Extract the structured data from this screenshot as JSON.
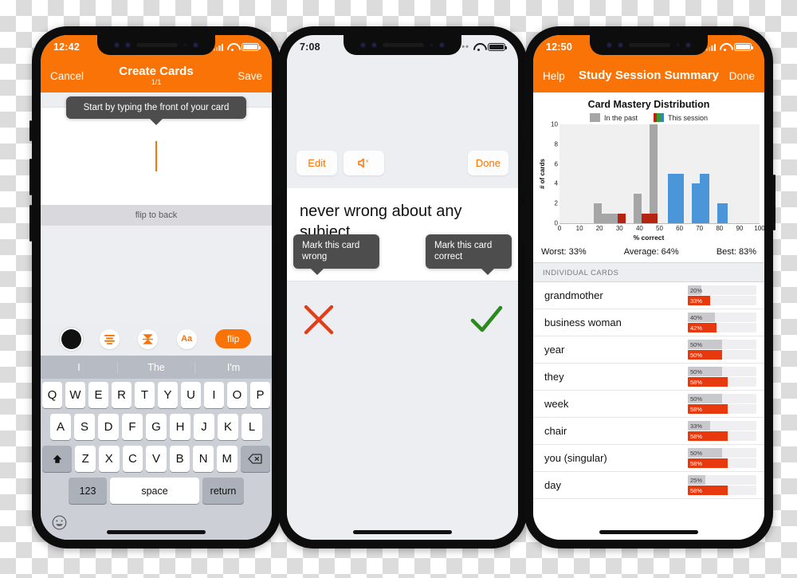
{
  "phone1": {
    "status": {
      "time": "12:42",
      "signal_icon": "signal-bars-icon",
      "wifi_icon": "wifi-icon",
      "battery_icon": "battery-icon"
    },
    "nav": {
      "left": "Cancel",
      "title": "Create Cards",
      "subtitle": "1/1",
      "right": "Save"
    },
    "tooltip": "Start by typing the front of your card",
    "flip_hint": "flip to back",
    "toolbar": {
      "color_swatch": "color-dot",
      "align_icon": "text-align-icon",
      "vertical_align_icon": "vertical-align-icon",
      "font_icon": "Aa",
      "flip_label": "flip"
    },
    "keyboard": {
      "suggestions": [
        "I",
        "The",
        "I'm"
      ],
      "row1": [
        "Q",
        "W",
        "E",
        "R",
        "T",
        "Y",
        "U",
        "I",
        "O",
        "P"
      ],
      "row2": [
        "A",
        "S",
        "D",
        "F",
        "G",
        "H",
        "J",
        "K",
        "L"
      ],
      "row3": [
        "Z",
        "X",
        "C",
        "V",
        "B",
        "N",
        "M"
      ],
      "shift_icon": "shift-arrow-icon",
      "backspace_icon": "backspace-icon",
      "numbers_label": "123",
      "space_label": "space",
      "return_label": "return",
      "emoji_icon": "emoji-face-icon"
    }
  },
  "phone2": {
    "status": {
      "time": "7:08",
      "signal_icon": "signal-dots-icon",
      "wifi_icon": "wifi-icon",
      "battery_icon": "battery-icon"
    },
    "controls": {
      "edit": "Edit",
      "mute_icon": "speaker-mute-icon",
      "done": "Done"
    },
    "card_text": "never wrong about any subject",
    "tooltip_wrong": "Mark this card wrong",
    "tooltip_correct": "Mark this card correct",
    "wrong_icon": "x-mark-icon",
    "correct_icon": "check-mark-icon",
    "colors": {
      "wrong": "#e33c18",
      "correct": "#2b8a1f"
    }
  },
  "phone3": {
    "status": {
      "time": "12:50",
      "signal_icon": "signal-bars-icon",
      "wifi_icon": "wifi-icon",
      "battery_icon": "battery-icon"
    },
    "nav": {
      "left": "Help",
      "title": "Study Session Summary",
      "right": "Done"
    },
    "stats": {
      "worst": "Worst: 33%",
      "average": "Average: 64%",
      "best": "Best: 83%"
    },
    "section_header": "INDIVIDUAL CARDS",
    "cards": [
      {
        "name": "grandmother",
        "past": "20%",
        "past_value": 20,
        "now": "33%",
        "now_value": 33
      },
      {
        "name": "business woman",
        "past": "40%",
        "past_value": 40,
        "now": "42%",
        "now_value": 42
      },
      {
        "name": "year",
        "past": "50%",
        "past_value": 50,
        "now": "50%",
        "now_value": 50
      },
      {
        "name": "they",
        "past": "50%",
        "past_value": 50,
        "now": "58%",
        "now_value": 58
      },
      {
        "name": "week",
        "past": "50%",
        "past_value": 50,
        "now": "58%",
        "now_value": 58
      },
      {
        "name": "chair",
        "past": "33%",
        "past_value": 33,
        "now": "58%",
        "now_value": 58
      },
      {
        "name": "you (singular)",
        "past": "50%",
        "past_value": 50,
        "now": "58%",
        "now_value": 58
      },
      {
        "name": "day",
        "past": "25%",
        "past_value": 25,
        "now": "58%",
        "now_value": 58
      }
    ]
  },
  "chart_data": {
    "type": "bar",
    "title": "Card Mastery Distribution",
    "xlabel": "% correct",
    "ylabel": "# of cards",
    "xlim": [
      0,
      100
    ],
    "ylim": [
      0,
      10
    ],
    "xticks": [
      0,
      10,
      20,
      30,
      40,
      50,
      60,
      70,
      80,
      90,
      100
    ],
    "yticks": [
      0,
      2,
      4,
      6,
      8,
      10
    ],
    "grid": false,
    "legend": [
      {
        "label": "In the past",
        "color": "#a6a6a6"
      },
      {
        "label": "This session",
        "color": "#c0210d"
      }
    ],
    "legend_position": "top-center",
    "colors": {
      "past": "#a6a6a6",
      "session_low": "#b52410",
      "session_high": "#4a96d8"
    },
    "bins": [
      {
        "x0": 17,
        "x1": 21,
        "past": 2,
        "session": 0
      },
      {
        "x0": 21,
        "x1": 25,
        "past": 1,
        "session": 0
      },
      {
        "x0": 25,
        "x1": 29,
        "past": 1,
        "session": 0
      },
      {
        "x0": 29,
        "x1": 33,
        "past": 0,
        "session": 1
      },
      {
        "x0": 33,
        "x1": 37,
        "past": 0,
        "session": 0
      },
      {
        "x0": 37,
        "x1": 41,
        "past": 3,
        "session": 0
      },
      {
        "x0": 41,
        "x1": 45,
        "past": 0,
        "session": 1
      },
      {
        "x0": 45,
        "x1": 49,
        "past": 10,
        "session": 1
      },
      {
        "x0": 54,
        "x1": 62,
        "past": 0,
        "session": 5
      },
      {
        "x0": 66,
        "x1": 70,
        "past": 0,
        "session": 4
      },
      {
        "x0": 70,
        "x1": 75,
        "past": 0,
        "session": 5
      },
      {
        "x0": 79,
        "x1": 84,
        "past": 0,
        "session": 2
      }
    ]
  }
}
